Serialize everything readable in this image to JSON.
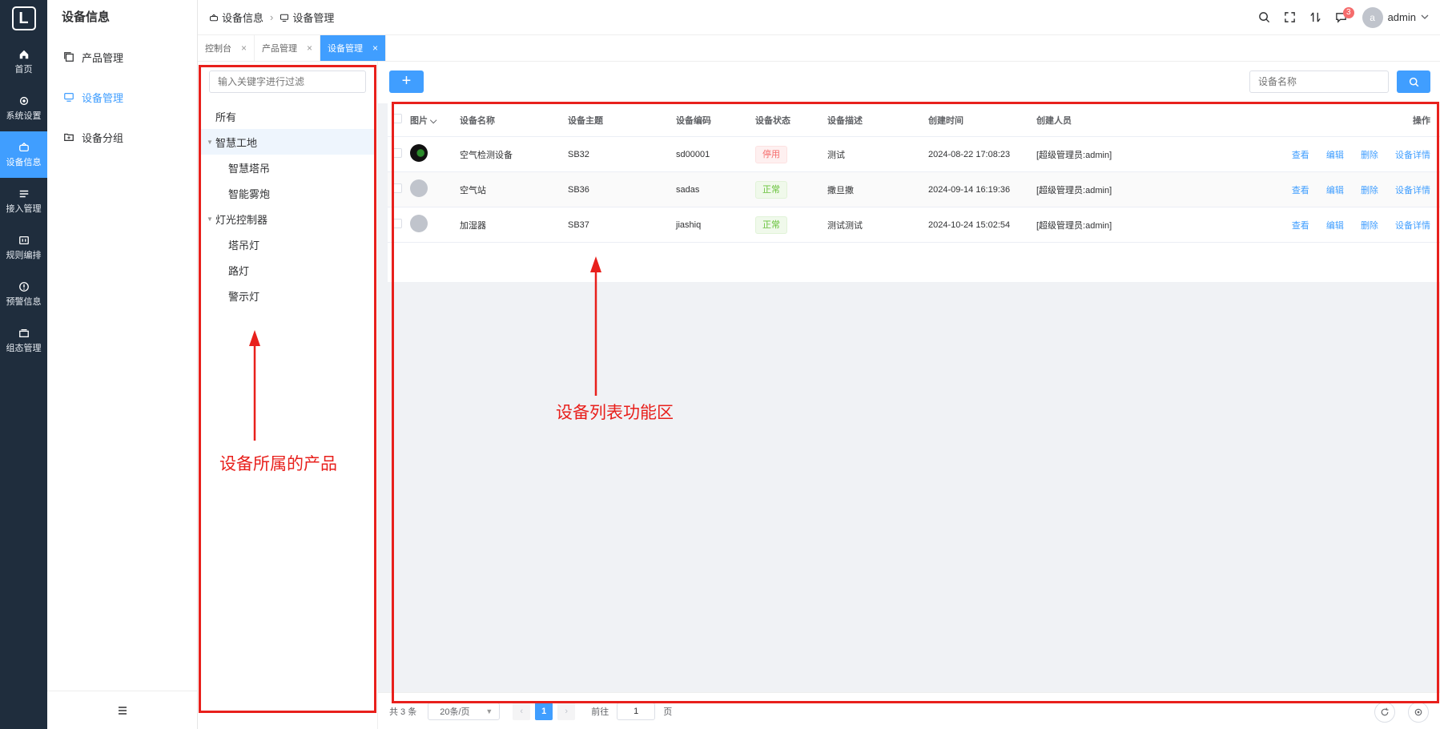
{
  "nav": {
    "logo": "L",
    "items": [
      {
        "label": "首页",
        "icon": "home-icon"
      },
      {
        "label": "系统设置",
        "icon": "gear-icon"
      },
      {
        "label": "设备信息",
        "icon": "device-icon"
      },
      {
        "label": "接入管理",
        "icon": "list-icon"
      },
      {
        "label": "规则编排",
        "icon": "rule-icon"
      },
      {
        "label": "预警信息",
        "icon": "alert-icon"
      },
      {
        "label": "组态管理",
        "icon": "layers-icon"
      }
    ]
  },
  "submenu": {
    "title": "设备信息",
    "items": [
      {
        "label": "产品管理"
      },
      {
        "label": "设备管理"
      },
      {
        "label": "设备分组"
      }
    ]
  },
  "header": {
    "breadcrumb": [
      "设备信息",
      "设备管理"
    ],
    "notification_count": "3",
    "avatar_letter": "a",
    "username": "admin"
  },
  "tabs": [
    {
      "label": "控制台"
    },
    {
      "label": "产品管理"
    },
    {
      "label": "设备管理"
    }
  ],
  "tree": {
    "placeholder": "输入关键字进行过滤",
    "nodes": [
      "所有",
      "智慧工地",
      "智慧塔吊",
      "智能雾炮",
      "灯光控制器",
      "塔吊灯",
      "路灯",
      "警示灯"
    ]
  },
  "toolbar": {
    "add_label": "+",
    "name_placeholder": "设备名称"
  },
  "table": {
    "columns": [
      "图片",
      "设备名称",
      "设备主题",
      "设备编码",
      "设备状态",
      "设备描述",
      "创建时间",
      "创建人员",
      "操作"
    ],
    "rows": [
      {
        "name": "空气检测设备",
        "topic": "SB32",
        "code": "sd00001",
        "status": "停用",
        "desc": "测试",
        "time": "2024-08-22 17:08:23",
        "user": "[超级管理员:admin]"
      },
      {
        "name": "空气站",
        "topic": "SB36",
        "code": "sadas",
        "status": "正常",
        "desc": "撒旦撒",
        "time": "2024-09-14 16:19:36",
        "user": "[超级管理员:admin]"
      },
      {
        "name": "加湿器",
        "topic": "SB37",
        "code": "jiashiq",
        "status": "正常",
        "desc": "测试测试",
        "time": "2024-10-24 15:02:54",
        "user": "[超级管理员:admin]"
      }
    ],
    "ops": [
      "查看",
      "编辑",
      "删除",
      "设备详情"
    ]
  },
  "pager": {
    "total": "共 3 条",
    "page_size": "20条/页",
    "current": "1",
    "goto_label": "前往",
    "goto_value": "1",
    "page_unit": "页"
  },
  "annotations": {
    "left": "设备所属的产品",
    "right": "设备列表功能区"
  },
  "colors": {
    "nav_bg": "#1f2d3d",
    "primary": "#409eff",
    "annotation_red": "#e8201c",
    "status_stop": "#f56c6c",
    "status_ok": "#67c23a"
  }
}
